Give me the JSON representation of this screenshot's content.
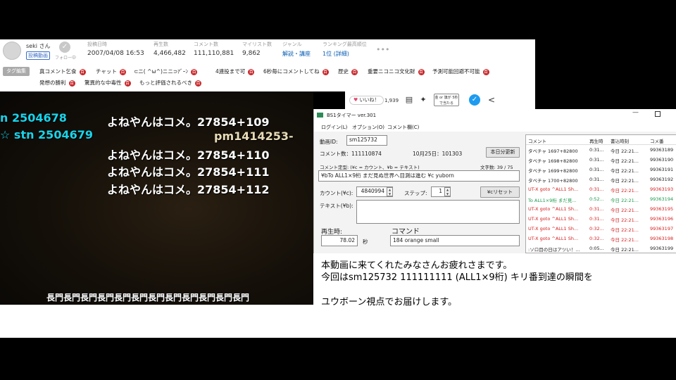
{
  "user": {
    "name": "seki さん",
    "tag": "投稿動画",
    "follow_label": "フォロー中"
  },
  "stats": [
    {
      "label": "投稿日時",
      "value": "2007/04/08 16:53"
    },
    {
      "label": "再生数",
      "value": "4,466,482"
    },
    {
      "label": "コメント数",
      "value": "111,110,881"
    },
    {
      "label": "マイリスト数",
      "value": "9,862"
    },
    {
      "label": "ジャンル",
      "value": "解説・講座"
    },
    {
      "label": "ランキング最高順位",
      "value": "1位 (詳細)"
    }
  ],
  "more_label": "•••",
  "tags": {
    "edit_label": "タグ編集",
    "row1": [
      "真コメント乞食",
      "チャット",
      "⊂ニ( ^ω^)ニニ⊃ｱﾞｰﾝ",
      "4連投まで可",
      "6秒毎にコメントしてね",
      "歴史",
      "重要ニコニコ文化財",
      "予測可能回避不可能"
    ],
    "row2": [
      "発想の勝利",
      "驚異的な中毒性",
      "もっと評価されるべき"
    ],
    "dic_badge": "百"
  },
  "video_comments": [
    {
      "text": "n 2504678",
      "color": "cyan"
    },
    {
      "text": "よねやんはコメ。27854+109",
      "color": "white"
    },
    {
      "text": "☆ stn 2504679",
      "color": "cyan"
    },
    {
      "text": "pm1414253-",
      "color": "beige"
    },
    {
      "text": "よねやんはコメ。27854+110",
      "color": "white"
    },
    {
      "text": "よねやんはコメ。27854+111",
      "color": "white"
    },
    {
      "text": "よねやんはコメ。27854+112",
      "color": "white"
    },
    {
      "text": "長門長門長門長門長門長門長門長門長門長門長門長門",
      "color": "white"
    }
  ],
  "actions": {
    "like_label": "いいね！",
    "like_count": "1,939",
    "compare_label": "金 or 旗が 5秒で当たる"
  },
  "bs1": {
    "title": "BS1タイマー ver.301",
    "menu": [
      "ログイン(L)",
      "オプション(O)",
      "コメント欄(C)"
    ],
    "video_id_label": "動画ID:",
    "video_id": "sm125732",
    "comment_count_label": "コメント数：111110874",
    "date_label": "10月25日：101303",
    "today_button": "本日分更新",
    "template_label": "コメント定型: (¥c = カウント、¥b = テキスト)",
    "char_count": "文字数: 39 / 75",
    "template_value": "¥bTo ALL1×9桁 まだ見ぬ世界へ目測は進む ¥c yuborn",
    "count_label": "カウント(¥c):",
    "count_value": "4840994",
    "step_label": "ステップ:",
    "step_value": "1",
    "reset_button": "¥cリセット",
    "text_label": "テキスト(¥b):",
    "playtime_label": "再生時:",
    "playtime_value": "78.02",
    "sec_label": "秒",
    "command_label": "コマンド",
    "command_value": "184 orange small",
    "table_headers": [
      "コメント",
      "再生時",
      "書込時刻",
      "コメ番"
    ],
    "table_rows": [
      {
        "comment": "タベチャ 1697+82800",
        "time": "0:31...",
        "written": "今日 22:21...",
        "no": "99363189",
        "color": "#222222"
      },
      {
        "comment": "タベチャ 1698+82800",
        "time": "0:31...",
        "written": "今日 22:21...",
        "no": "99363190",
        "color": "#222222"
      },
      {
        "comment": "タベチャ 1699+82800",
        "time": "0:31...",
        "written": "今日 22:21...",
        "no": "99363191",
        "color": "#222222"
      },
      {
        "comment": "タベチャ 1700+82800",
        "time": "0:31...",
        "written": "今日 22:21...",
        "no": "99363192",
        "color": "#222222"
      },
      {
        "comment": "UT-X goto ^ALL1 Sh...",
        "time": "0:31...",
        "written": "今日 22:21...",
        "no": "99363193",
        "color": "#d42020"
      },
      {
        "comment": "To ALL1×9桁 まだ見...",
        "time": "0:52...",
        "written": "今日 22:21...",
        "no": "99363194",
        "color": "#1a9a4a"
      },
      {
        "comment": "UT-X goto ^ALL1 Sh...",
        "time": "0:31...",
        "written": "今日 22:21...",
        "no": "99363195",
        "color": "#d42020"
      },
      {
        "comment": "UT-X goto ^ALL1 Sh...",
        "time": "0:31...",
        "written": "今日 22:21...",
        "no": "99363196",
        "color": "#d42020"
      },
      {
        "comment": "UT-X goto ^ALL1 Sh...",
        "time": "0:32...",
        "written": "今日 22:21...",
        "no": "99363197",
        "color": "#d42020"
      },
      {
        "comment": "UT-X goto ^ALL1 Sh...",
        "time": "0:32...",
        "written": "今日 22:21...",
        "no": "99363198",
        "color": "#d42020"
      },
      {
        "comment": ":ソロ目の日はアツい！...",
        "time": "0:05...",
        "written": "今日 22:21...",
        "no": "99363199",
        "color": "#222222"
      }
    ]
  },
  "description": [
    "本動画に来てくれたみなさんお疲れさまです。",
    "今回はsm125732 111111111 (ALL1×9桁) キリ番到達の瞬間を",
    "ユウボーン視点でお届けします。"
  ]
}
